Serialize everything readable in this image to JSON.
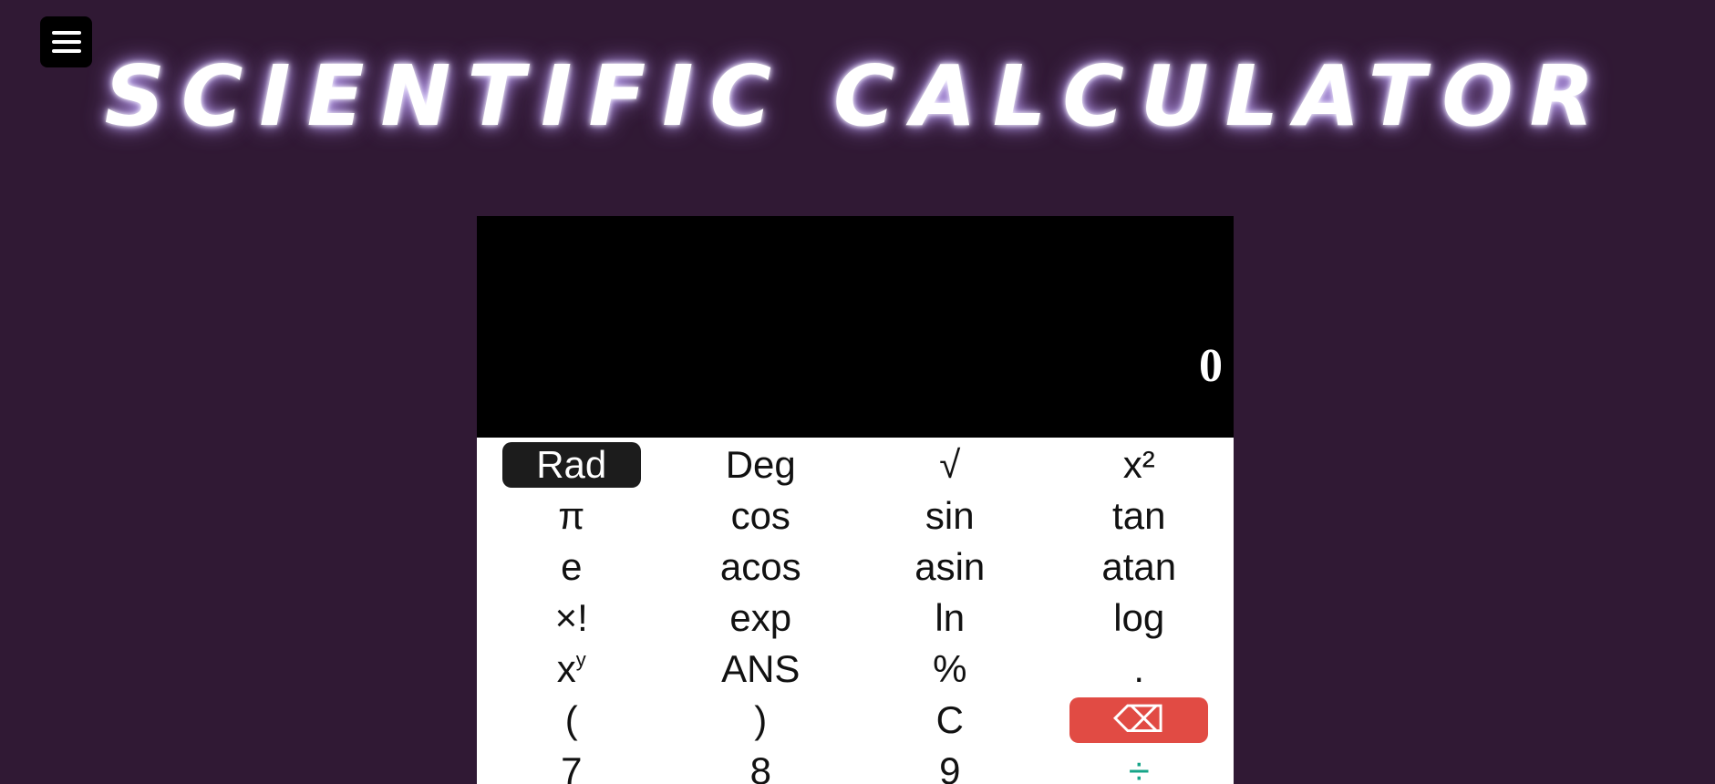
{
  "header": {
    "menu_icon": "hamburger-menu-icon",
    "title": "SCIENTIFIC CALCULATOR"
  },
  "display": {
    "value": "0"
  },
  "keys": [
    {
      "label": "Rad",
      "style": "active"
    },
    {
      "label": "Deg"
    },
    {
      "label": "√"
    },
    {
      "label": "x²"
    },
    {
      "label": "π"
    },
    {
      "label": "cos"
    },
    {
      "label": "sin"
    },
    {
      "label": "tan"
    },
    {
      "label": "e"
    },
    {
      "label": "acos"
    },
    {
      "label": "asin"
    },
    {
      "label": "atan"
    },
    {
      "label": "×!"
    },
    {
      "label": "exp"
    },
    {
      "label": "ln"
    },
    {
      "label": "log"
    },
    {
      "label": "x",
      "sup": "y"
    },
    {
      "label": "ANS"
    },
    {
      "label": "%"
    },
    {
      "label": "."
    },
    {
      "label": "("
    },
    {
      "label": ")"
    },
    {
      "label": "C"
    },
    {
      "label": "⌫",
      "style": "danger",
      "icon": "backspace-icon"
    },
    {
      "label": "7"
    },
    {
      "label": "8"
    },
    {
      "label": "9"
    },
    {
      "label": "÷",
      "style": "op"
    }
  ],
  "colors": {
    "background": "#301934",
    "display": "#000000",
    "active_key": "#1c1c1c",
    "backspace_key": "#e14b44",
    "operator": "#17a589"
  }
}
